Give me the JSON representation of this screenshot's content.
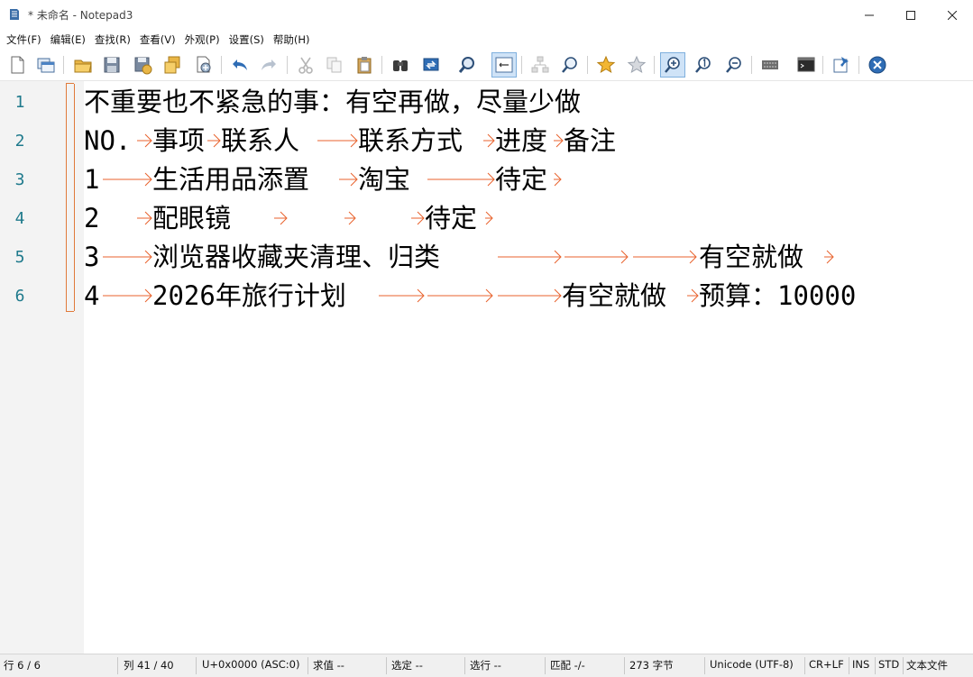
{
  "window": {
    "title": "* 未命名 - Notepad3",
    "minimize_glyph": "—",
    "maximize_glyph": "☐",
    "close_glyph": "✕"
  },
  "menu": [
    "文件(F)",
    "编辑(E)",
    "查找(R)",
    "查看(V)",
    "外观(P)",
    "设置(S)",
    "帮助(H)"
  ],
  "toolbar": {
    "icons": [
      "new-file-icon",
      "new-window-icon",
      "open-folder-icon",
      "save-icon",
      "save-as-icon",
      "save-copy-icon",
      "favorite-file-icon",
      "undo-icon",
      "redo-icon",
      "cut-icon",
      "copy-icon",
      "paste-icon",
      "find-icon",
      "replace-icon",
      "find-next-icon",
      "word-wrap-icon",
      "tree-view-icon",
      "search-zoom-icon",
      "bookmark-add-icon",
      "bookmark-remove-icon",
      "zoom-in-icon",
      "zoom-reset-icon",
      "zoom-out-icon",
      "encoding-icon",
      "terminal-icon",
      "pin-icon",
      "exit-icon"
    ],
    "active": [
      "word-wrap-icon",
      "zoom-in-icon"
    ]
  },
  "editor": {
    "line_numbers": [
      "1",
      "2",
      "3",
      "4",
      "5",
      "6"
    ],
    "lines": [
      {
        "segments": [
          "不重要也不紧急的事：有空再做，尽量少做"
        ]
      },
      {
        "segments": [
          "NO.",
          "事项",
          "联系人",
          "联系方式",
          "进度",
          "备注"
        ]
      },
      {
        "segments": [
          "1",
          "生活用品添置",
          "淘宝",
          "",
          "待定",
          ""
        ]
      },
      {
        "segments": [
          "2",
          "配眼镜",
          "",
          "",
          "待定"
        ]
      },
      {
        "segments": [
          "3",
          "浏览器收藏夹清理、归类",
          "",
          "",
          "",
          "有空就做",
          ""
        ]
      },
      {
        "segments": [
          "4",
          "2026年旅行计划",
          "",
          "",
          "",
          "有空就做",
          "预算：10000"
        ]
      }
    ],
    "tab_color": "#e8622c"
  },
  "status": {
    "line": "行 6 / 6",
    "col": "列 41 / 40",
    "unicode": "U+0x0000 (ASC:0)",
    "sum": "求值 --",
    "selection": "选定 --",
    "sel_lines": "选行 --",
    "match": "匹配 -/-",
    "bytes": "273 字节",
    "encoding": "Unicode (UTF-8)",
    "eol": "CR+LF",
    "ins": "INS",
    "std": "STD",
    "filetype": "文本文件"
  }
}
